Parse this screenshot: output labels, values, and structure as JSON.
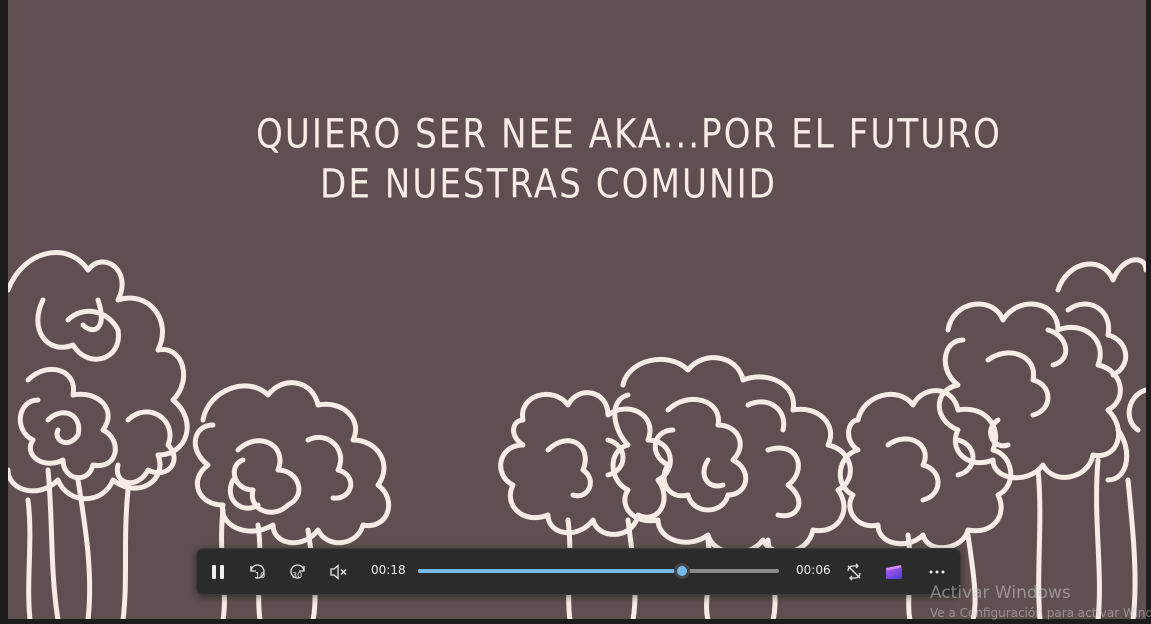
{
  "video": {
    "background_color": "#5f4f50",
    "caption_lines": [
      "QUIERO SER NEE AKA...POR EL FUTURO",
      "DE NUESTRAS COMUNID"
    ]
  },
  "player": {
    "elapsed_time": "00:18",
    "remaining_time": "00:06",
    "progress_fraction": 0.73,
    "accent_color": "#76b9ed",
    "buttons": {
      "play_pause": "pause-icon",
      "skip_back": "rewind-10-icon",
      "skip_back_label": "10",
      "skip_forward": "forward-30-icon",
      "skip_forward_label": "30",
      "volume": "muted-volume-icon",
      "repeat": "repeat-icon",
      "clipchamp": "clipchamp-icon",
      "more": "more-options-icon"
    }
  },
  "watermark": {
    "title": "Activar Windows",
    "subtitle": "Ve a Configuración para activar Windows."
  }
}
